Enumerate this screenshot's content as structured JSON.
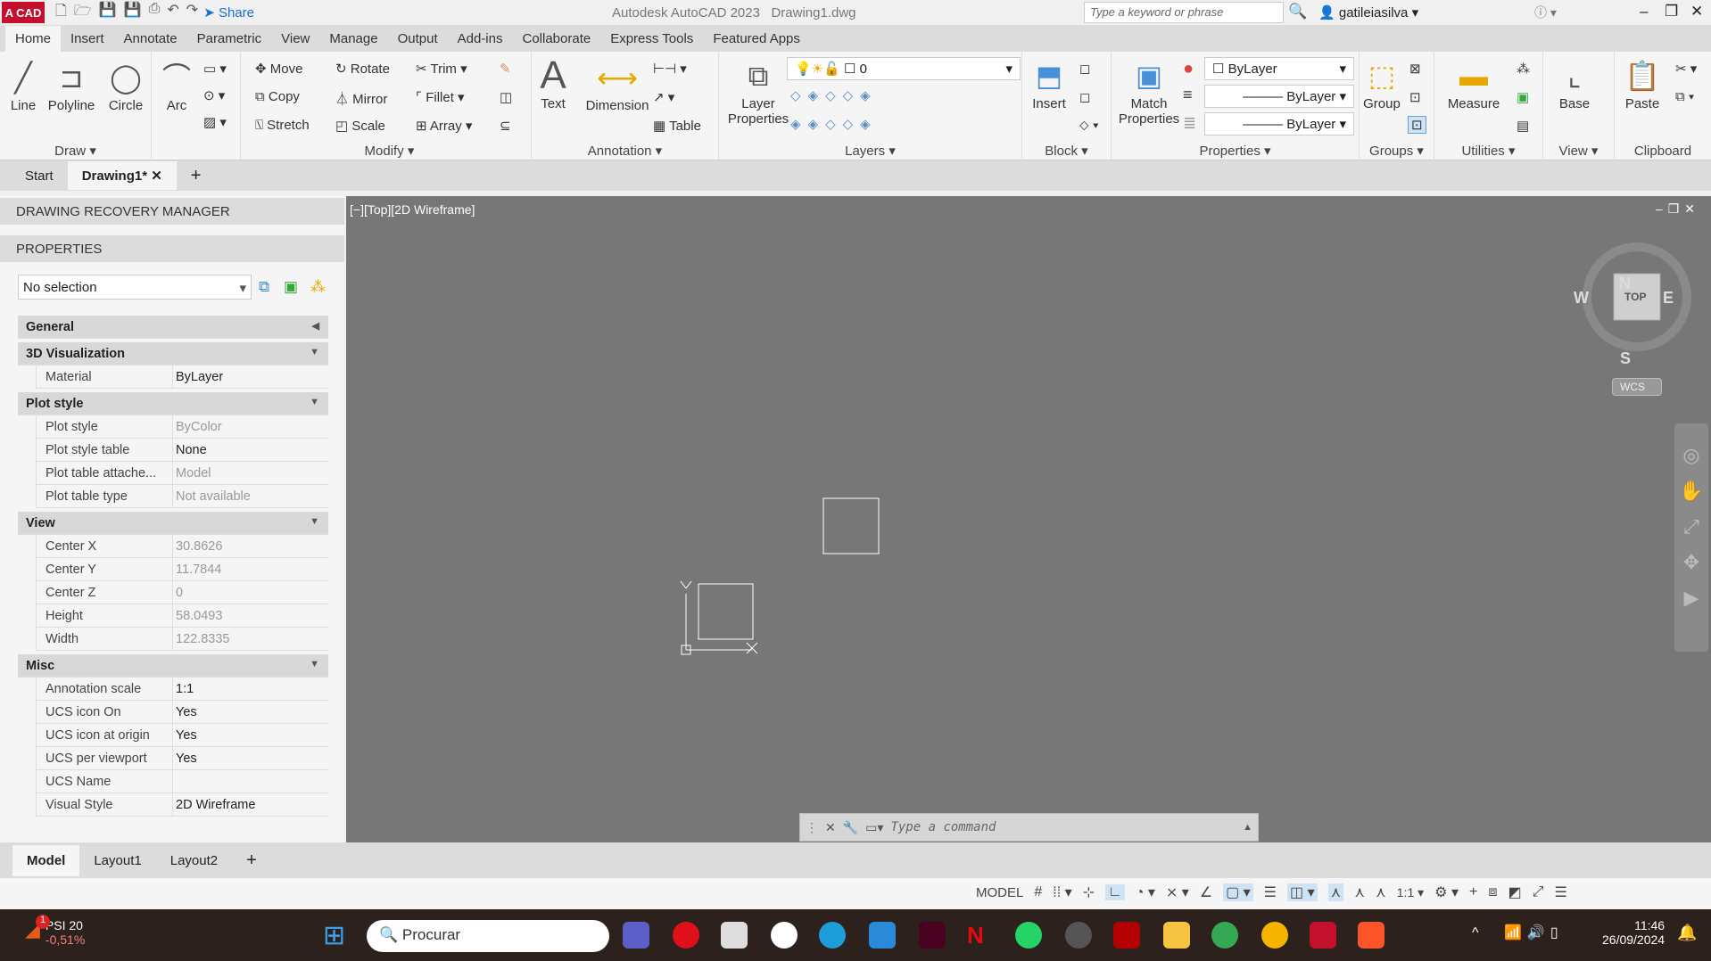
{
  "titlebar": {
    "logo": "A CAD",
    "share": "Share",
    "app_title": "Autodesk AutoCAD 2023",
    "file": "Drawing1.dwg",
    "search_placeholder": "Type a keyword or phrase",
    "user": "gatileiasilva"
  },
  "ribbon_tabs": [
    "Home",
    "Insert",
    "Annotate",
    "Parametric",
    "View",
    "Manage",
    "Output",
    "Add-ins",
    "Collaborate",
    "Express Tools",
    "Featured Apps"
  ],
  "draw": {
    "title": "Draw",
    "tools": [
      "Line",
      "Polyline",
      "Circle",
      "Arc"
    ]
  },
  "modify": {
    "title": "Modify",
    "tools": [
      "Move",
      "Rotate",
      "Trim",
      "Copy",
      "Mirror",
      "Fillet",
      "Stretch",
      "Scale",
      "Array"
    ]
  },
  "annotation": {
    "title": "Annotation",
    "tools": [
      "Text",
      "Dimension",
      "Table"
    ]
  },
  "layers": {
    "title": "Layers",
    "layer_props": "Layer Properties",
    "current_layer": "0"
  },
  "block": {
    "title": "Block",
    "insert": "Insert"
  },
  "properties": {
    "title": "Properties",
    "match": "Match Properties",
    "color": "ByLayer",
    "lineweight": "ByLayer",
    "linetype": "ByLayer"
  },
  "groups": {
    "title": "Groups",
    "group": "Group"
  },
  "utilities": {
    "title": "Utilities",
    "measure": "Measure"
  },
  "view": {
    "title": "View",
    "base": "Base"
  },
  "clipboard": {
    "title": "Clipboard",
    "paste": "Paste"
  },
  "doc_tabs": [
    "Start",
    "Drawing1*"
  ],
  "left_panel": {
    "recovery": "DRAWING RECOVERY MANAGER",
    "properties": "PROPERTIES",
    "selection": "No selection",
    "rows": [
      {
        "type": "cat",
        "label": "General",
        "arrow": "◀"
      },
      {
        "type": "cat",
        "label": "3D Visualization",
        "arrow": "▼"
      },
      {
        "type": "prop",
        "label": "Material",
        "value": "ByLayer"
      },
      {
        "type": "cat",
        "label": "Plot style",
        "arrow": "▼"
      },
      {
        "type": "prop",
        "label": "Plot style",
        "value": "ByColor",
        "dim": true
      },
      {
        "type": "prop",
        "label": "Plot style table",
        "value": "None"
      },
      {
        "type": "prop",
        "label": "Plot table attache...",
        "value": "Model",
        "dim": true
      },
      {
        "type": "prop",
        "label": "Plot table type",
        "value": "Not available",
        "dim": true
      },
      {
        "type": "cat",
        "label": "View",
        "arrow": "▼"
      },
      {
        "type": "prop",
        "label": "Center X",
        "value": "30.8626",
        "dim": true
      },
      {
        "type": "prop",
        "label": "Center Y",
        "value": "11.7844",
        "dim": true
      },
      {
        "type": "prop",
        "label": "Center Z",
        "value": "0",
        "dim": true
      },
      {
        "type": "prop",
        "label": "Height",
        "value": "58.0493",
        "dim": true
      },
      {
        "type": "prop",
        "label": "Width",
        "value": "122.8335",
        "dim": true
      },
      {
        "type": "cat",
        "label": "Misc",
        "arrow": "▼"
      },
      {
        "type": "prop",
        "label": "Annotation scale",
        "value": "1:1"
      },
      {
        "type": "prop",
        "label": "UCS icon On",
        "value": "Yes"
      },
      {
        "type": "prop",
        "label": "UCS icon at origin",
        "value": "Yes"
      },
      {
        "type": "prop",
        "label": "UCS per viewport",
        "value": "Yes"
      },
      {
        "type": "prop",
        "label": "UCS Name",
        "value": ""
      },
      {
        "type": "prop",
        "label": "Visual Style",
        "value": "2D Wireframe"
      }
    ]
  },
  "viewport": {
    "label": "[−][Top][2D Wireframe]",
    "viewcube": {
      "n": "N",
      "s": "S",
      "e": "E",
      "w": "W",
      "top": "TOP",
      "wcs": "WCS"
    }
  },
  "command": {
    "placeholder": "Type a command"
  },
  "layout_tabs": [
    "Model",
    "Layout1",
    "Layout2"
  ],
  "status": {
    "model": "MODEL",
    "scale": "1:1"
  },
  "taskbar": {
    "stock": "PSI 20",
    "change": "-0,51%",
    "badge": "1",
    "search": "Procurar",
    "time": "11:46",
    "date": "26/09/2024"
  }
}
